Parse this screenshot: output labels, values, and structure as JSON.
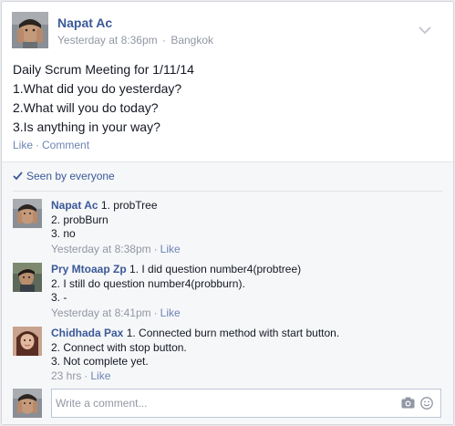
{
  "post": {
    "author": "Napat Ac",
    "time": "Yesterday at 8:36pm",
    "separator": "·",
    "location": "Bangkok",
    "body_lines": [
      "Daily Scrum Meeting for 1/11/14",
      "1.What did you do yesterday?",
      "2.What will you do today?",
      "3.Is anything in your way?"
    ],
    "actions": {
      "like": "Like",
      "dot": "·",
      "comment": "Comment"
    }
  },
  "seen": {
    "label": "Seen by everyone"
  },
  "comments": [
    {
      "author": "Napat Ac",
      "lines": [
        "1. probTree",
        "2. probBurn",
        "3. no"
      ],
      "time": "Yesterday at 8:38pm",
      "dot": "·",
      "like": "Like"
    },
    {
      "author": "Pry Mtoaap Zp",
      "lines": [
        "1. I did question number4(probtree)",
        "2. I still do question number4(probburn).",
        "3. -"
      ],
      "time": "Yesterday at 8:41pm",
      "dot": "·",
      "like": "Like"
    },
    {
      "author": "Chidhada Pax",
      "lines": [
        "1. Connected burn method with start button.",
        "2. Connect with stop button.",
        "3. Not complete yet."
      ],
      "time": "23 hrs",
      "dot": "·",
      "like": "Like"
    }
  ],
  "composer": {
    "placeholder": "Write a comment..."
  },
  "icons": {
    "post_menu": "chevron-down-icon",
    "seen": "checkmark-icon",
    "photo": "camera-icon",
    "sticker": "smiley-icon"
  },
  "colors": {
    "link": "#3b5998",
    "action_link": "#6d84b4",
    "meta": "#9197a3",
    "text": "#141823",
    "comments_bg": "#f6f7f9"
  }
}
